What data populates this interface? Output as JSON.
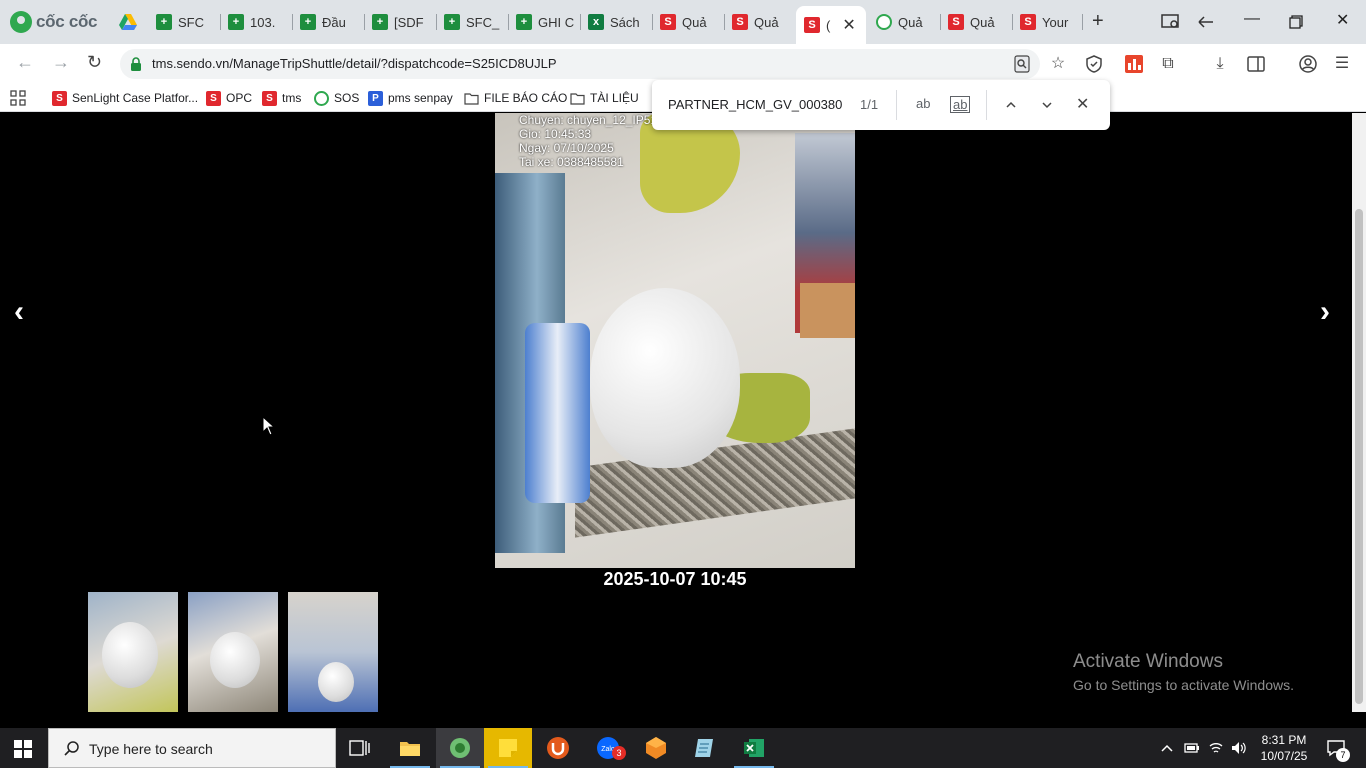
{
  "browser": {
    "logo_text": "cốc cốc",
    "tabs": [
      {
        "label": "SFC",
        "favicon": "sheet"
      },
      {
        "label": "103.",
        "favicon": "sheet"
      },
      {
        "label": "Đầu",
        "favicon": "sheet"
      },
      {
        "label": "[SDF",
        "favicon": "sheet"
      },
      {
        "label": "SFC_",
        "favicon": "sheet"
      },
      {
        "label": "GHI C",
        "favicon": "sheet"
      },
      {
        "label": "Sách",
        "favicon": "excel"
      },
      {
        "label": "Quả",
        "favicon": "sendo"
      },
      {
        "label": "Quả",
        "favicon": "sendo"
      },
      {
        "label": "(",
        "favicon": "sendo",
        "active": true
      },
      {
        "label": "Quả",
        "favicon": "senpay"
      },
      {
        "label": "Quả",
        "favicon": "sendo"
      },
      {
        "label": "Your",
        "favicon": "sendo"
      }
    ],
    "url": "tms.sendo.vn/ManageTripShuttle/detail/?dispatchcode=S25ICD8UJLP"
  },
  "bookmarks": [
    {
      "label": "SenLight Case Platfor...",
      "icon": "sendo"
    },
    {
      "label": "OPC",
      "icon": "sendo"
    },
    {
      "label": "tms",
      "icon": "sendo"
    },
    {
      "label": "SOS",
      "icon": "senpay"
    },
    {
      "label": "pms senpay",
      "icon": "p"
    },
    {
      "label": "FILE BÁO CÁO",
      "icon": "folder"
    },
    {
      "label": "TÀI LIỆU",
      "icon": "folder"
    }
  ],
  "find": {
    "query": "PARTNER_HCM_GV_000380",
    "count": "1/1",
    "opt_case": "ab",
    "opt_word": "ab"
  },
  "viewer": {
    "prev_arrow": "‹",
    "next_arrow": "›",
    "stamp": {
      "line1": "Chuyen: chuyen_12_IP51",
      "line2": "Gio: 10:45:33",
      "line3": "Ngay: 07/10/2025",
      "line4": "Tai xe: 0388485581"
    },
    "caption": "2025-10-07 10:45",
    "thumbnail_count": 3
  },
  "watermark": {
    "title": "Activate Windows",
    "subtitle": "Go to Settings to activate Windows."
  },
  "taskbar": {
    "search_placeholder": "Type here to search",
    "time": "8:31 PM",
    "date": "10/07/25",
    "zalo_badge": "3",
    "notification_count": "7"
  },
  "colors": {
    "tabstrip_bg": "#dfe3e7",
    "sendo_red": "#e0282e",
    "sheets_green": "#1e8e3e",
    "taskbar_bg": "#1f1f22"
  }
}
